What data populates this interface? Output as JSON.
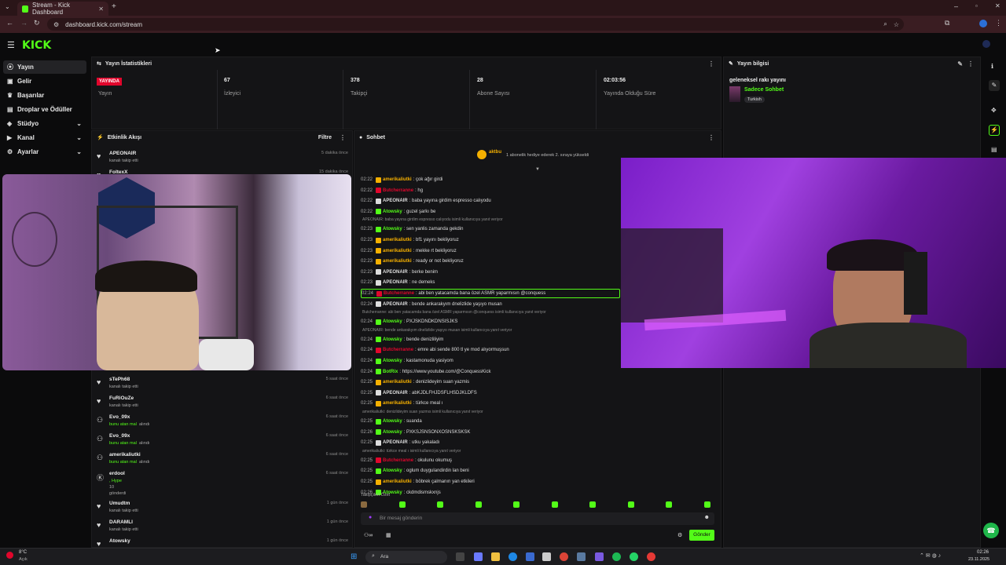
{
  "browser": {
    "tab_title": "Stream - Kick Dashboard",
    "url": "dashboard.kick.com/stream"
  },
  "header": {
    "logo": "KICK"
  },
  "sidebar": {
    "items": [
      {
        "label": "Yayın",
        "icon": "broadcast-icon",
        "active": true
      },
      {
        "label": "Gelir",
        "icon": "revenue-icon"
      },
      {
        "label": "Başarılar",
        "icon": "achievements-icon"
      },
      {
        "label": "Droplar ve Ödüller",
        "icon": "gift-icon"
      },
      {
        "label": "Stüdyo",
        "icon": "studio-icon"
      },
      {
        "label": "Kanal",
        "icon": "channel-icon"
      },
      {
        "label": "Ayarlar",
        "icon": "settings-icon"
      }
    ]
  },
  "stats": {
    "title": "Yayın İstatistikleri",
    "live_badge": "YAYINDA",
    "cells": [
      {
        "value": "",
        "label": "Yayın"
      },
      {
        "value": "67",
        "label": "İzleyici"
      },
      {
        "value": "378",
        "label": "Takipçi"
      },
      {
        "value": "28",
        "label": "Abone Sayısı"
      },
      {
        "value": "02:03:56",
        "label": "Yayında Olduğu Süre"
      }
    ]
  },
  "stream_info": {
    "title": "Yayın bilgisi",
    "stream_title": "geleneksel rakı yayını",
    "category": "Sadece Sohbet",
    "tag": "Turkish"
  },
  "activity": {
    "title": "Etkinlik Akışı",
    "filter": "Filtre",
    "items_top": [
      {
        "name": "APEONAIR",
        "sub": "kanalı takip etti",
        "time": "5 dakika önce",
        "icon": "heart"
      },
      {
        "name": "FoltexX",
        "sub": "",
        "time": "15 dakika önce",
        "icon": "heart"
      }
    ],
    "items_bottom": [
      {
        "name": "sTePh68",
        "sub": "kanalı takip etti",
        "time": "5 saat önce",
        "icon": "heart",
        "green": false
      },
      {
        "name": "FuRiOuZe",
        "sub": "kanalı takip etti",
        "time": "6 saat önce",
        "icon": "heart",
        "green": false
      },
      {
        "name": "Evo_09x",
        "sub": "bunu atan mal",
        "sub2": "alındı",
        "time": "6 saat önce",
        "icon": "share",
        "green": true
      },
      {
        "name": "Evo_09x",
        "sub": "bunu atan mal",
        "sub2": "alındı",
        "time": "6 saat önce",
        "icon": "share",
        "green": true
      },
      {
        "name": "amerikaliutki",
        "sub": "bunu atan mal",
        "sub2": "alındı",
        "time": "6 saat önce",
        "icon": "share",
        "green": true
      }
    ],
    "erdool": {
      "name": "erdool",
      "line1": ", Hype",
      "line2": "10",
      "line3": "gönderdi",
      "time": "6 saat önce"
    },
    "items_end": [
      {
        "name": "Umudtm",
        "sub": "kanalı takip etti",
        "time": "1 gün önce"
      },
      {
        "name": "DARAMLI",
        "sub": "kanalı takip etti",
        "time": "1 gün önce"
      },
      {
        "name": "Atowsky",
        "sub": "",
        "time": "1 gün önce"
      }
    ]
  },
  "chat": {
    "title": "Sohbet",
    "gift_user": "aktbu",
    "gift_text": "1 abonelik hediye ederek 2. sıraya yükseldi",
    "lines": [
      {
        "t": "02:22",
        "u": "amerikaliutki",
        "c": "#f5b000",
        "m": ": çok ağır girdi"
      },
      {
        "t": "02:22",
        "u": "Butcherranne",
        "c": "#e1062c",
        "m": ": hg"
      },
      {
        "t": "02:22",
        "u": "APEONAIR",
        "c": "#dddddd",
        "m": ": baba yayına girdim espresso calıyodu"
      },
      {
        "t": "02:22",
        "u": "Atowsky",
        "c": "#53fc18",
        "m": ": guzel şarkı be"
      },
      {
        "reply": "APEONAIR: baba yayına girdim espresso calıyodu isimli kullanıcıya yanıt veriyor"
      },
      {
        "t": "02:23",
        "u": "Atowsky",
        "c": "#53fc18",
        "m": ": sen yanlis zamanda gekdin"
      },
      {
        "t": "02:23",
        "u": "amerikaliutki",
        "c": "#f5b000",
        "m": ": bf1 yayını bekliyoruz"
      },
      {
        "t": "02:23",
        "u": "amerikaliutki",
        "c": "#f5b000",
        "m": ": mekke rt bekliyoruz"
      },
      {
        "t": "02:23",
        "u": "amerikaliutki",
        "c": "#f5b000",
        "m": ": ready or not bekliyoruz"
      },
      {
        "t": "02:23",
        "u": "APEONAIR",
        "c": "#dddddd",
        "m": ": berke benim"
      },
      {
        "t": "02:23",
        "u": "APEONAIR",
        "c": "#dddddd",
        "m": ": ne demeks"
      },
      {
        "t": "02:24",
        "u": "Butcherranne",
        "c": "#e1062c",
        "m": ": abi ben yatacamda bana özel ASMR yaparmısın @conquess",
        "hl": true
      },
      {
        "t": "02:24",
        "u": "APEONAIR",
        "c": "#dddddd",
        "m": ": bende ankarakyım dnelizlide yaşıyo musan"
      },
      {
        "reply": "Butcherranne: abi ben yatacamda bana özel ASMR yaparmısın @conquess isimli kullanıcıya yanıt veriyor"
      },
      {
        "t": "02:24",
        "u": "Atowsky",
        "c": "#53fc18",
        "m": ": PXJSKDNDKDNSISJKS"
      },
      {
        "reply": "APEONAIR: bende ankarakyım dnelizlide yaşıyo musan isimli kullanıcıya yanıt veriyor"
      },
      {
        "t": "02:24",
        "u": "Atowsky",
        "c": "#53fc18",
        "m": ": bende denizliliyim"
      },
      {
        "t": "02:24",
        "u": "Butcherranne",
        "c": "#e1062c",
        "m": ": emre abi sende 800 tl ye mod alıyormuşsun"
      },
      {
        "t": "02:24",
        "u": "Atowsky",
        "c": "#53fc18",
        "m": ": kastamonuda yasiyom"
      },
      {
        "t": "02:24",
        "u": "BotRix",
        "c": "#53fc18",
        "m": ": https://www.youtube.com/@ConquessKick"
      },
      {
        "t": "02:25",
        "u": "amerikaliutki",
        "c": "#f5b000",
        "m": ": denizlideyim suan yazmis"
      },
      {
        "t": "02:25",
        "u": "APEONAIR",
        "c": "#dddddd",
        "m": ": abKJDLFHJDSFLHSDJKLDFS"
      },
      {
        "t": "02:25",
        "u": "amerikaliutki",
        "c": "#f5b000",
        "m": ": türkce meal ı"
      },
      {
        "reply": "amerikaliutki: denizlideyim suan yazmıs isimli kullanıcıya yanıt veriyor"
      },
      {
        "t": "02:25",
        "u": "Atowsky",
        "c": "#53fc18",
        "m": ": suanda"
      },
      {
        "t": "02:26",
        "u": "Atowsky",
        "c": "#53fc18",
        "m": ": PXKSJSNSONXOSNSKSKSK"
      },
      {
        "t": "02:25",
        "u": "APEONAIR",
        "c": "#dddddd",
        "m": ": utku yakaladı"
      },
      {
        "reply": "amerikaliutki: türkce meal ı isimli kullanıcıya yanıt veriyor"
      },
      {
        "t": "02:25",
        "u": "Butcherranne",
        "c": "#e1062c",
        "m": ": okulunu okumuş"
      },
      {
        "t": "02:25",
        "u": "Atowsky",
        "c": "#53fc18",
        "m": ": oglum duygulandirdin lan beni"
      },
      {
        "t": "02:25",
        "u": "amerikaliutki",
        "c": "#f5b000",
        "m": ": böbrek çalmanın yan etkileri"
      },
      {
        "t": "02:26",
        "u": "Atowsky",
        "c": "#53fc18",
        "m": ": ckdmdismskxnjs"
      }
    ],
    "followers_only": "Takipçileri Özel",
    "input_placeholder": "Bir mesaj gönderin",
    "send": "Gönder"
  },
  "taskbar": {
    "weather_temp": "8°C",
    "weather_desc": "Açık",
    "search": "Ara",
    "time": "02:26",
    "date": "23.11.2025"
  }
}
